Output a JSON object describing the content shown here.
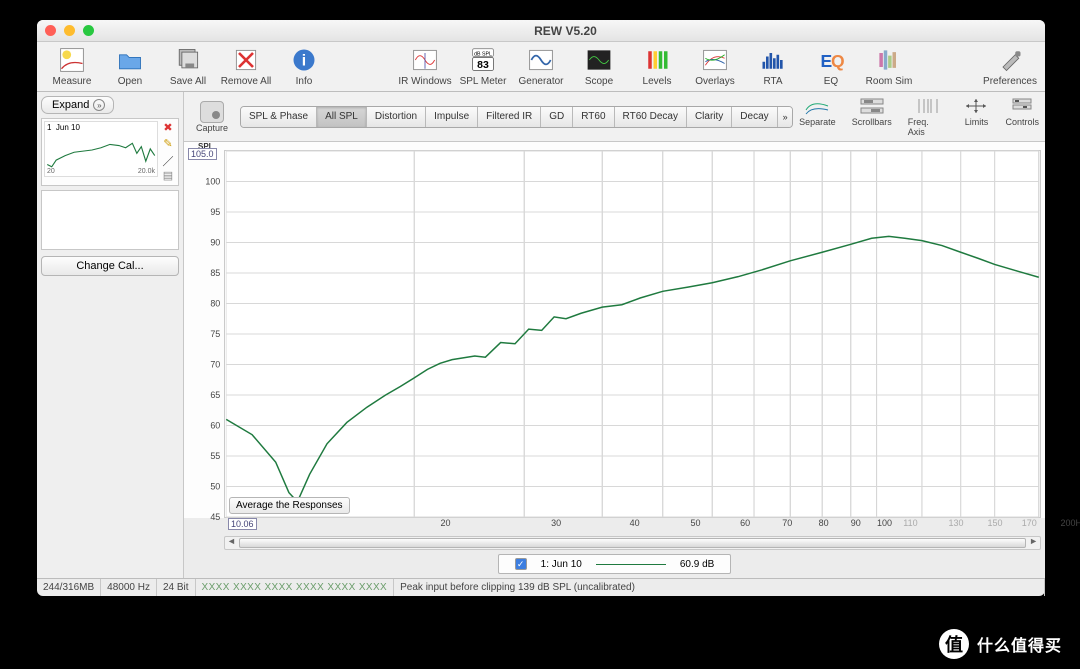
{
  "window": {
    "title": "REW V5.20"
  },
  "toolbar": [
    {
      "id": "measure",
      "label": "Measure"
    },
    {
      "id": "open",
      "label": "Open"
    },
    {
      "id": "saveall",
      "label": "Save All"
    },
    {
      "id": "removeall",
      "label": "Remove All"
    },
    {
      "id": "info",
      "label": "Info"
    },
    {
      "id": "spacer",
      "spacer": true
    },
    {
      "id": "irwindows",
      "label": "IR Windows"
    },
    {
      "id": "splmeter",
      "label": "SPL Meter",
      "badge": "83",
      "badge2": "dB SPL"
    },
    {
      "id": "generator",
      "label": "Generator"
    },
    {
      "id": "scope",
      "label": "Scope"
    },
    {
      "id": "levels",
      "label": "Levels"
    },
    {
      "id": "overlays",
      "label": "Overlays"
    },
    {
      "id": "rta",
      "label": "RTA"
    },
    {
      "id": "eq",
      "label": "EQ"
    },
    {
      "id": "roomsim",
      "label": "Room Sim"
    },
    {
      "id": "spacer2",
      "spacer": true
    },
    {
      "id": "preferences",
      "label": "Preferences"
    }
  ],
  "sidebar": {
    "expand": "Expand",
    "measurement": {
      "index": "1",
      "name": "Jun 10",
      "x0": "20",
      "x1": "20.0k"
    },
    "change_cal": "Change Cal..."
  },
  "capture_label": "Capture",
  "tabs": [
    "SPL & Phase",
    "All SPL",
    "Distortion",
    "Impulse",
    "Filtered IR",
    "GD",
    "RT60",
    "RT60 Decay",
    "Clarity",
    "Decay",
    "»"
  ],
  "tabs_selected": 1,
  "view_tools": [
    "Separate",
    "Scrollbars",
    "Freq. Axis",
    "Limits",
    "Controls"
  ],
  "chart": {
    "y_title": "SPL",
    "y_cursor": "105.0",
    "x_cursor": "10.06",
    "avg_btn": "Average the Responses",
    "x_unit": "Hz"
  },
  "chart_data": {
    "type": "line",
    "xscale": "log",
    "xlim": [
      10,
      200
    ],
    "ylim": [
      45,
      105
    ],
    "yticks": [
      45,
      50,
      55,
      60,
      65,
      70,
      75,
      80,
      85,
      90,
      95,
      100,
      105
    ],
    "xticks": [
      20,
      30,
      40,
      50,
      60,
      70,
      80,
      90,
      100,
      110,
      130,
      150,
      170,
      200
    ],
    "series": [
      {
        "name": "1: Jun 10",
        "color": "#1f7a3f",
        "x": [
          10,
          11,
          12,
          12.6,
          13,
          13.6,
          14.5,
          15.6,
          16.8,
          18,
          19,
          20,
          21,
          22,
          23,
          25,
          26,
          27.5,
          29,
          30.5,
          32,
          33.5,
          35,
          37,
          40,
          43,
          46,
          50,
          55,
          60,
          66,
          72,
          80,
          90,
          100,
          108,
          115,
          122,
          130,
          140,
          150,
          160,
          170,
          185,
          200
        ],
        "y": [
          61,
          58.5,
          54,
          49,
          47.5,
          52,
          57,
          60.5,
          63,
          65,
          66.4,
          67.8,
          69.2,
          70.2,
          70.8,
          71.4,
          71.2,
          73.6,
          73.4,
          75.8,
          75.6,
          77.8,
          77.5,
          78.4,
          79.4,
          79.8,
          80.9,
          82,
          82.7,
          83.4,
          84.4,
          85.5,
          87,
          88.4,
          89.7,
          90.7,
          91,
          90.7,
          90.3,
          89.5,
          88.4,
          87.4,
          86.4,
          85.3,
          84.3
        ]
      }
    ]
  },
  "legend": {
    "series_label": "1: Jun 10",
    "value": "60.9 dB"
  },
  "status": {
    "mem": "244/316MB",
    "rate": "48000 Hz",
    "bits": "24 Bit",
    "blurred": "XXXX XXXX  XXXX XXXX  XXXX XXXX",
    "peak": "Peak input before clipping 139 dB SPL (uncalibrated)"
  },
  "watermark": "什么值得买"
}
